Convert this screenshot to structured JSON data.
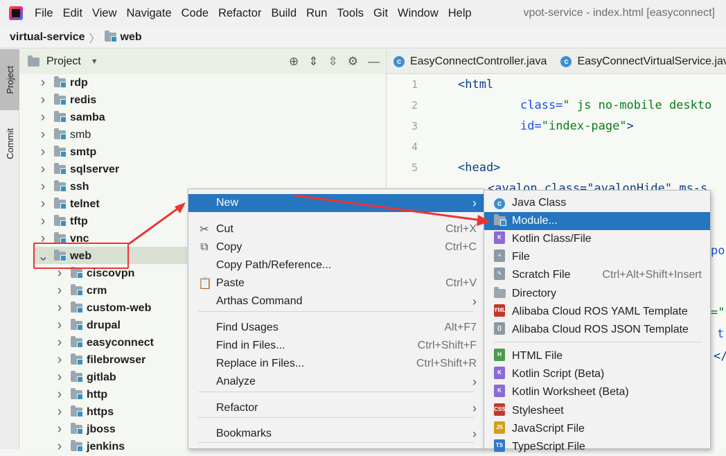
{
  "menubar": {
    "items": [
      "File",
      "Edit",
      "View",
      "Navigate",
      "Code",
      "Refactor",
      "Build",
      "Run",
      "Tools",
      "Git",
      "Window",
      "Help"
    ],
    "window_title": "vpot-service - index.html [easyconnect]"
  },
  "breadcrumb": {
    "root": "virtual-service",
    "child": "web"
  },
  "sidestrip": {
    "project": "Project",
    "commit": "Commit"
  },
  "project_panel": {
    "title": "Project",
    "tree": [
      "rdp",
      "redis",
      "samba",
      "smb",
      "smtp",
      "sqlserver",
      "ssh",
      "telnet",
      "tftp",
      "vnc",
      "web",
      "ciscovpn",
      "crm",
      "custom-web",
      "drupal",
      "easyconnect",
      "filebrowser",
      "gitlab",
      "http",
      "https",
      "jboss",
      "jenkins"
    ]
  },
  "editor": {
    "tabs": [
      "EasyConnectController.java",
      "EasyConnectVirtualService.java"
    ],
    "lines": [
      {
        "n": "1",
        "tag": "<html"
      },
      {
        "n": "2",
        "attr": "class=",
        "str": "\" js no-mobile deskto"
      },
      {
        "n": "3",
        "attr": "id=",
        "str": "\"index-page\"",
        "tag": ">"
      },
      {
        "n": "4"
      },
      {
        "n": "5",
        "tag": "<head>"
      }
    ],
    "partial_line6": "<avalon class=\"avalonHide\" ms-s",
    "right_fragments": [
      "po",
      "=\"",
      "t",
      "</"
    ]
  },
  "context_menu": {
    "items": [
      {
        "label": "New",
        "shortcut": ""
      },
      {
        "label": "Cut",
        "shortcut": "Ctrl+X"
      },
      {
        "label": "Copy",
        "shortcut": "Ctrl+C"
      },
      {
        "label": "Copy Path/Reference...",
        "shortcut": ""
      },
      {
        "label": "Paste",
        "shortcut": "Ctrl+V"
      },
      {
        "label": "Arthas Command",
        "shortcut": ""
      },
      {
        "label": "Find Usages",
        "shortcut": "Alt+F7"
      },
      {
        "label": "Find in Files...",
        "shortcut": "Ctrl+Shift+F"
      },
      {
        "label": "Replace in Files...",
        "shortcut": "Ctrl+Shift+R"
      },
      {
        "label": "Analyze",
        "shortcut": ""
      },
      {
        "label": "Refactor",
        "shortcut": ""
      },
      {
        "label": "Bookmarks",
        "shortcut": ""
      }
    ]
  },
  "new_submenu": {
    "items": [
      {
        "label": "Java Class",
        "shortcut": ""
      },
      {
        "label": "Module...",
        "shortcut": ""
      },
      {
        "label": "Kotlin Class/File",
        "shortcut": ""
      },
      {
        "label": "File",
        "shortcut": ""
      },
      {
        "label": "Scratch File",
        "shortcut": "Ctrl+Alt+Shift+Insert"
      },
      {
        "label": "Directory",
        "shortcut": ""
      },
      {
        "label": "Alibaba Cloud ROS YAML Template",
        "shortcut": ""
      },
      {
        "label": "Alibaba Cloud ROS JSON Template",
        "shortcut": ""
      },
      {
        "label": "HTML File",
        "shortcut": ""
      },
      {
        "label": "Kotlin Script (Beta)",
        "shortcut": ""
      },
      {
        "label": "Kotlin Worksheet (Beta)",
        "shortcut": ""
      },
      {
        "label": "Stylesheet",
        "shortcut": ""
      },
      {
        "label": "JavaScript File",
        "shortcut": ""
      },
      {
        "label": "TypeScript File",
        "shortcut": ""
      }
    ]
  },
  "colors": {
    "accent": "#2675bf",
    "annotation": "#e33333"
  }
}
